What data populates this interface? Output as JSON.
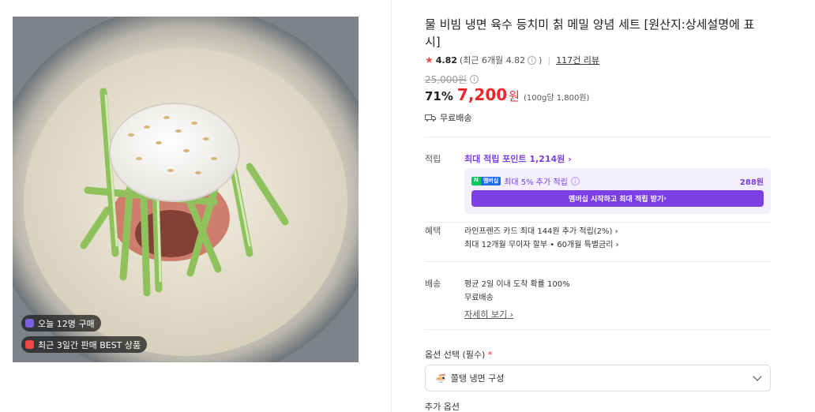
{
  "product": {
    "title": "물 비빔 냉면 육수 등치미 칡 메밀 양념 세트 [원산지:상세설명에 표시]",
    "rating": "4.82",
    "rating_recent": "(최근 6개월 4.82",
    "rating_recent_close": ")",
    "reviews": "117건 리뷰",
    "original_price": "25,000원",
    "discount": "71%",
    "price": "7,200",
    "price_unit": "원",
    "unit_price": "(100g당 1,800원)",
    "shipping_free": "무료배송"
  },
  "image": {
    "badge_today": "오늘 12명 구매",
    "badge_best": "최근 3일간 판매 BEST 상품"
  },
  "points": {
    "label": "적립",
    "max_point": "최대 적립 포인트 1,214원",
    "npay_logo_n": "N",
    "npay_logo_p": "멤버십",
    "npay_text": "최대 5% 추가 적립",
    "npay_amount": "288원",
    "member_button": "멤버십 시작하고 최대 적립 받기"
  },
  "benefits": {
    "label": "혜택",
    "line1": "라인프렌즈 카드 최대 144원 추가 적립(2%)",
    "line2": "최대 12개월 무이자 할부 • 60개월 특별금리"
  },
  "delivery": {
    "label": "배송",
    "line1": "평균 2일 이내 도착 확률 100%",
    "line2": "무료배송",
    "more": "자세히 보기"
  },
  "options": {
    "label": "옵션 선택 (필수)",
    "required_mark": "*",
    "selected": "쫄탱 냉면 구성",
    "extra_label": "추가 옵션"
  },
  "colors": {
    "accent": "#7b3fe4",
    "price": "#f0242b",
    "star": "#f04848"
  }
}
